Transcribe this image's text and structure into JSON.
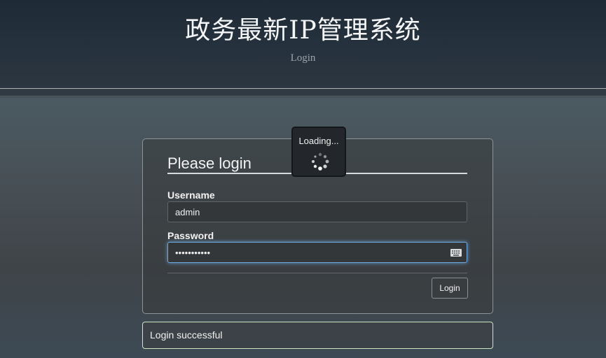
{
  "header": {
    "title": "政务最新IP管理系统",
    "subtitle": "Login"
  },
  "login_form": {
    "title": "Please login",
    "username_label": "Username",
    "username_value": "admin",
    "password_label": "Password",
    "password_value": "•••••••••••",
    "password_field_icon": "keyboard-icon",
    "submit_label": "Login"
  },
  "loading_overlay": {
    "text": "Loading...",
    "icon": "spinner-icon"
  },
  "status": {
    "message": "Login successful",
    "border_color": "#cfe6c2"
  },
  "colors": {
    "focus_glow": "#6fa8dc",
    "header_bg": "#26323d"
  }
}
